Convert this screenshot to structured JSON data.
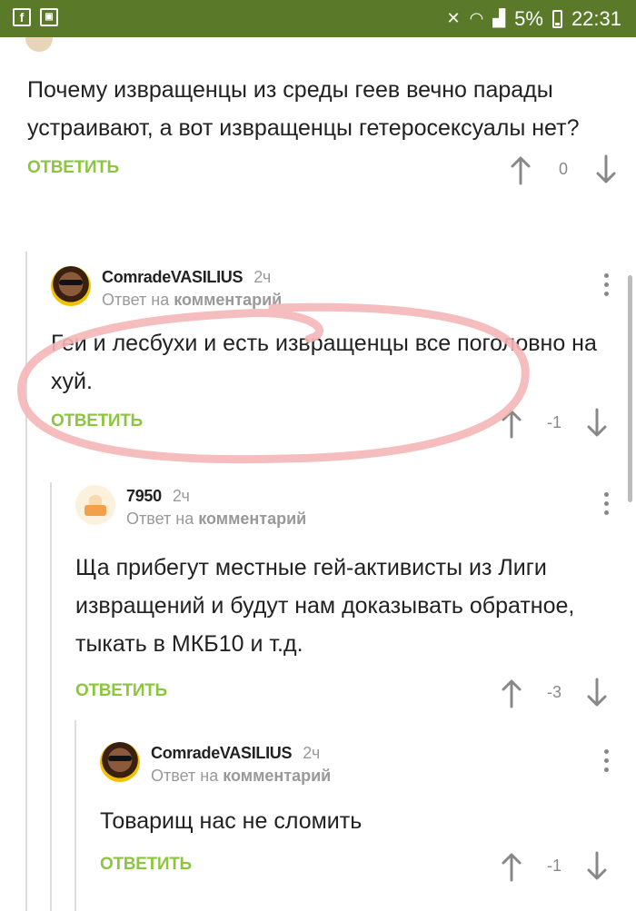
{
  "status_bar": {
    "time": "22:31",
    "battery": "5%",
    "left_icons": [
      "facebook-icon",
      "gallery-icon"
    ],
    "right_icons": [
      "mute-icon",
      "wifi-icon",
      "signal-icon",
      "battery-icon"
    ]
  },
  "comments": [
    {
      "text": "Почему извращенцы из среды геев вечно парады устраивают, а вот извращенцы гетеросексуалы нет?",
      "reply_label": "ОТВЕТИТЬ",
      "score": "0"
    },
    {
      "username": "ComradeVASILIUS",
      "time": "2ч",
      "reply_prefix": "Ответ на",
      "reply_target": "комментарий",
      "text": "Геи и лесбухи и есть извращенцы все поголовно на хуй.",
      "reply_label": "ОТВЕТИТЬ",
      "score": "-1"
    },
    {
      "username": "7950",
      "time": "2ч",
      "reply_prefix": "Ответ на",
      "reply_target": "комментарий",
      "text": "Ща прибегут местные гей-активисты из Лиги извращений и будут нам доказывать обратное, тыкать в МКБ10 и т.д.",
      "reply_label": "ОТВЕТИТЬ",
      "score": "-3"
    },
    {
      "username": "ComradeVASILIUS",
      "time": "2ч",
      "reply_prefix": "Ответ на",
      "reply_target": "комментарий",
      "text": "Товарищ нас не сломить",
      "reply_label": "ОТВЕТИТЬ",
      "score": "-1"
    }
  ],
  "colors": {
    "status_bar": "#5a7a2a",
    "reply_green": "#8cc63f",
    "highlight": "#f4b6b6"
  }
}
